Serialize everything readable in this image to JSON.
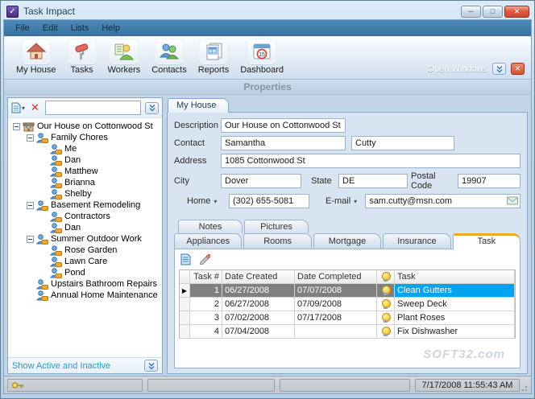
{
  "window": {
    "title": "Task Impact",
    "menu": [
      {
        "label": "File"
      },
      {
        "label": "Edit"
      },
      {
        "label": "Lists"
      },
      {
        "label": "Help"
      }
    ],
    "toolbar": [
      {
        "label": "My House"
      },
      {
        "label": "Tasks"
      },
      {
        "label": "Workers"
      },
      {
        "label": "Contacts"
      },
      {
        "label": "Reports"
      },
      {
        "label": "Dashboard"
      }
    ],
    "open_windows_label": "Open Windows",
    "properties_title": "Properties"
  },
  "sidebar": {
    "search_value": "",
    "tree": [
      {
        "label": "Our House on Cottonwood St",
        "level": 0,
        "house": true,
        "expandable": true
      },
      {
        "label": "Family Chores",
        "level": 1,
        "expandable": true
      },
      {
        "label": "Me",
        "level": 2
      },
      {
        "label": "Dan",
        "level": 2
      },
      {
        "label": "Matthew",
        "level": 2
      },
      {
        "label": "Brianna",
        "level": 2
      },
      {
        "label": "Shelby",
        "level": 2
      },
      {
        "label": "Basement Remodeling",
        "level": 1,
        "expandable": true
      },
      {
        "label": "Contractors",
        "level": 2
      },
      {
        "label": "Dan",
        "level": 2
      },
      {
        "label": "Summer Outdoor Work",
        "level": 1,
        "expandable": true
      },
      {
        "label": "Rose Garden",
        "level": 2
      },
      {
        "label": "Lawn Care",
        "level": 2
      },
      {
        "label": "Pond",
        "level": 2
      },
      {
        "label": "Upstairs Bathroom Repairs",
        "level": 1
      },
      {
        "label": "Annual Home Maintenance",
        "level": 1
      }
    ],
    "footer_label": "Show Active and Inactive"
  },
  "main": {
    "page_tab": "My House",
    "form": {
      "description_label": "Description",
      "description": "Our House on Cottonwood St",
      "contact_label": "Contact",
      "contact_first": "Samantha",
      "contact_last": "Cutty",
      "address_label": "Address",
      "address": "1085 Cottonwood St",
      "city_label": "City",
      "city": "Dover",
      "state_label": "State",
      "state": "DE",
      "postal_label": "Postal Code",
      "postal": "19907",
      "phone_type_label": "Home",
      "phone": "(302) 655-5081",
      "email_label": "E-mail",
      "email": "sam.cutty@msn.com"
    },
    "tabs_upper": [
      {
        "label": "Notes"
      },
      {
        "label": "Pictures"
      }
    ],
    "tabs_lower": [
      {
        "label": "Appliances"
      },
      {
        "label": "Rooms"
      },
      {
        "label": "Mortgage"
      },
      {
        "label": "Insurance"
      },
      {
        "label": "Task",
        "active": true
      }
    ],
    "table": {
      "columns": {
        "num": "Task #",
        "created": "Date Created",
        "completed": "Date Completed",
        "task": "Task"
      },
      "rows": [
        {
          "num": "1",
          "created": "06/27/2008",
          "completed": "07/07/2008",
          "task": "Clean Gutters",
          "selected": true
        },
        {
          "num": "2",
          "created": "06/27/2008",
          "completed": "07/09/2008",
          "task": "Sweep Deck"
        },
        {
          "num": "3",
          "created": "07/02/2008",
          "completed": "07/17/2008",
          "task": "Plant Roses"
        },
        {
          "num": "4",
          "created": "07/04/2008",
          "completed": "",
          "task": "Fix Dishwasher"
        }
      ]
    },
    "watermark": "SOFT32.com"
  },
  "statusbar": {
    "datetime": "7/17/2008 11:55:43 AM"
  },
  "colors": {
    "menubar_blue": "#3D7AAE",
    "tab_accent_orange": "#F5A623",
    "selection_blue": "#00A3EE",
    "selection_gray": "#7F7F7F",
    "link_teal": "#2D97CF"
  }
}
